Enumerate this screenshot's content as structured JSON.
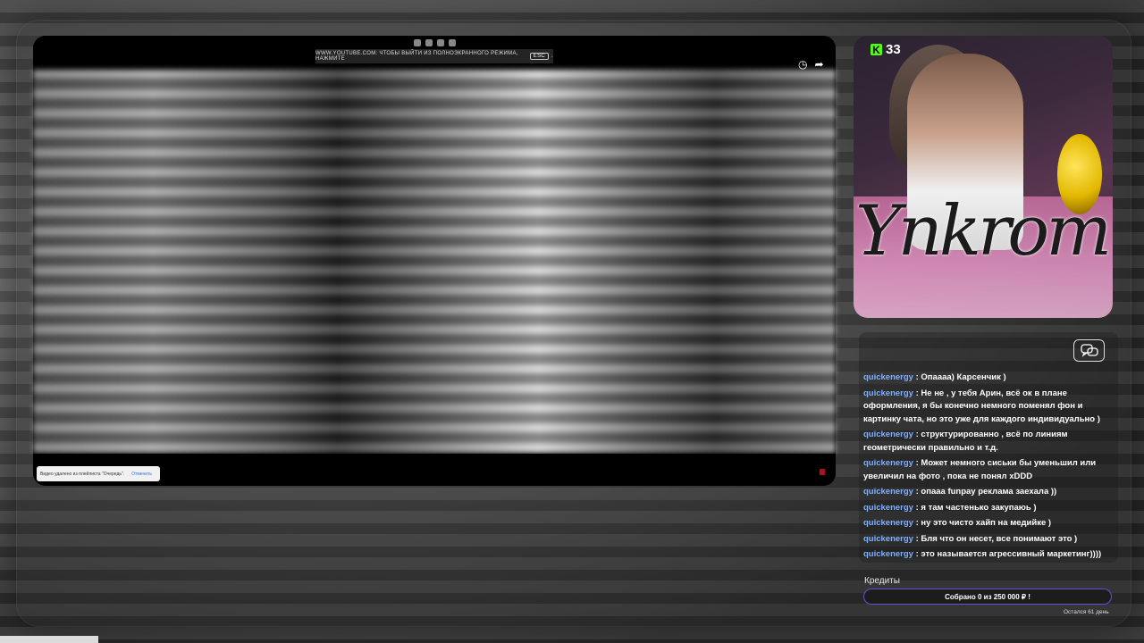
{
  "player": {
    "fullscreen_notice_text": "WWW.YOUTUBE.COM: ЧТОБЫ ВЫЙТИ ИЗ ПОЛНОЭКРАННОГО РЕЖИМА, НАЖМИТЕ",
    "fullscreen_key": "ESC",
    "fullscreen_tail": ".",
    "toast_text": "Видео удалено из плейлиста \"Очередь\".",
    "toast_cancel": "Отменить"
  },
  "stream": {
    "platform_icon": "kick-logo",
    "platform_letter": "K",
    "viewer_count": "33",
    "art_text": "Ynkrom"
  },
  "chat": {
    "button_icon": "chat-bubbles-icon",
    "messages": [
      {
        "user": "quickenergy",
        "text": ": Опаааа) Карсенчик )"
      },
      {
        "user": "quickenergy",
        "text": ": Не не , у тебя Арин, всё ок в плане оформления, я бы конечно немного поменял фон и картинку чата, но это уже для каждого индивидуально )"
      },
      {
        "user": "quickenergy",
        "text": ": структурированно , всё по линиям геометрически правильно и т.д."
      },
      {
        "user": "quickenergy",
        "text": ": Может немного сиськи бы уменьшил или увеличил на фото , пока не понял xDDD"
      },
      {
        "user": "quickenergy",
        "text": ": опааа funpay реклама заехала ))"
      },
      {
        "user": "quickenergy",
        "text": ": я там частенько закупаюь )"
      },
      {
        "user": "quickenergy",
        "text": ": ну это чисто хайп на медийке )"
      },
      {
        "user": "quickenergy",
        "text": ": Бля что он несет, все понимают это )"
      },
      {
        "user": "quickenergy",
        "text": ": это называется агрессивный маркетинг))))"
      }
    ]
  },
  "credits": {
    "label": "Кредиты",
    "progress_text": "Собрано 0  из 250 000 ₽ !",
    "progress_fraction": 0,
    "days_left": "Остался 61 день"
  },
  "colors": {
    "username": "#7fb1ff",
    "kick_green": "#53fc18",
    "progress_border": "#6b4dd8"
  }
}
